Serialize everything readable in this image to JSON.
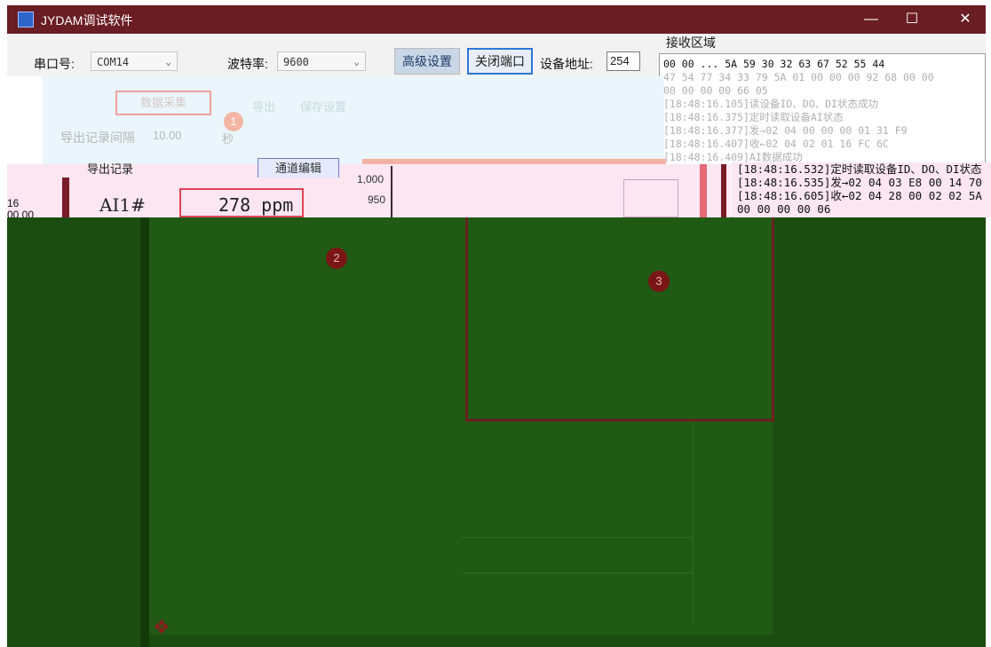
{
  "window": {
    "title": "JYDAM调试软件",
    "minimize_glyph": "—",
    "maximize_glyph": "☐",
    "close_glyph": "✕"
  },
  "toolbar": {
    "port_label": "串口号:",
    "port_value": "COM14",
    "baud_label": "波特率:",
    "baud_value": "9600",
    "advanced_button": "高级设置",
    "close_port_button": "关闭端口",
    "address_label": "设备地址:",
    "address_value": "254"
  },
  "receive": {
    "label": "接收区域",
    "lines": [
      "00 00 ... 5A 59 30 32 63 67 52 55 44",
      "47 54 77 34 33 79 5A 01 00 00 00 92 68 00 00",
      "00 00 00 00 66 05",
      "[18:48:16.105]读设备ID、DO、DI状态成功",
      "[18:48:16.375]定时读取设备AI状态",
      "[18:48:16.377]发→02 04 00 00 00 01 31 F9",
      "[18:48:16.407]收←02 04 02 01 16 FC 6C",
      "[18:48:16.409]AI数据成功"
    ],
    "lower_lines": [
      "[18:48:16.532]定时读取设备ID、DO、DI状态",
      "[18:48:16.535]发→02 04 03 E8 00 14 70",
      "[18:48:16.605]收←02 04 28 00 02 02 5A",
      "00 00 00 00 06"
    ]
  },
  "faded_panel": {
    "tab_active": "数据采集",
    "tab_export": "导出",
    "tab_settings": "保存设置",
    "interval_label": "导出记录间隔",
    "interval_value": "10.00",
    "interval_unit": "秒",
    "badge_1": "1"
  },
  "channel": {
    "export_button": "导出记录",
    "edit_button": "通道编辑",
    "name": "AI1#",
    "value": "278 ppm",
    "y_tick_top": "1,000",
    "y_tick_second": "950",
    "left_cut_1": "16",
    "left_cut_2": "00 00"
  },
  "badges": {
    "two": "2",
    "three": "3"
  },
  "icons": {
    "app": "app-icon",
    "tool": "wrench-icon",
    "dropdown": "chevron-down-icon"
  },
  "colors": {
    "titlebar": "#6b1d24",
    "green_area": "#1c4d10",
    "pink_strip": "#fbe6f2",
    "value_box_border": "#e0445a"
  }
}
